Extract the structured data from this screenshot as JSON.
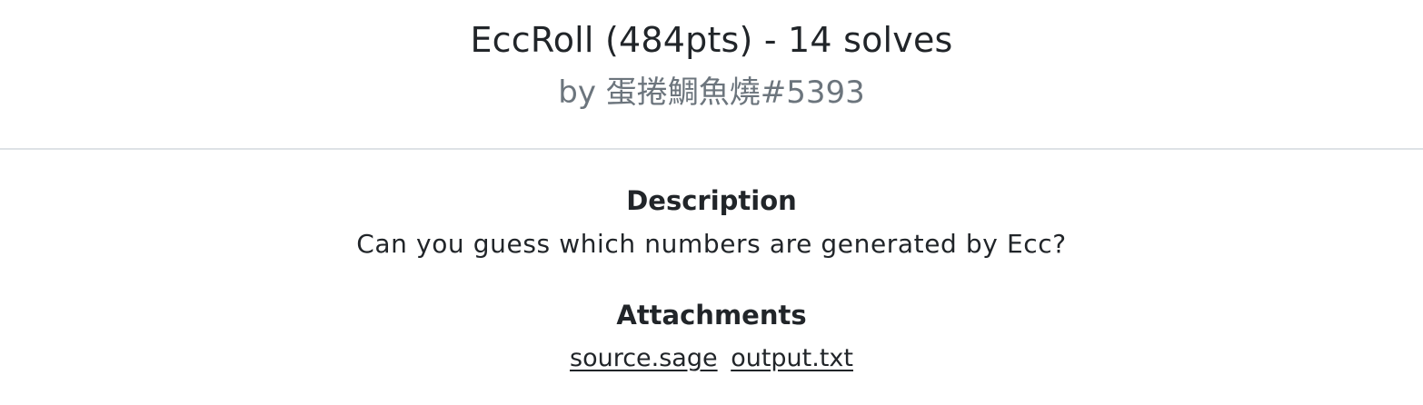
{
  "challenge": {
    "title": "EccRoll (484pts) - 14 solves",
    "author": "by 蛋捲鯛魚燒#5393"
  },
  "description": {
    "heading": "Description",
    "text": "Can you guess which numbers are generated by Ecc?"
  },
  "attachments": {
    "heading": "Attachments",
    "files": [
      "source.sage",
      "output.txt"
    ]
  }
}
